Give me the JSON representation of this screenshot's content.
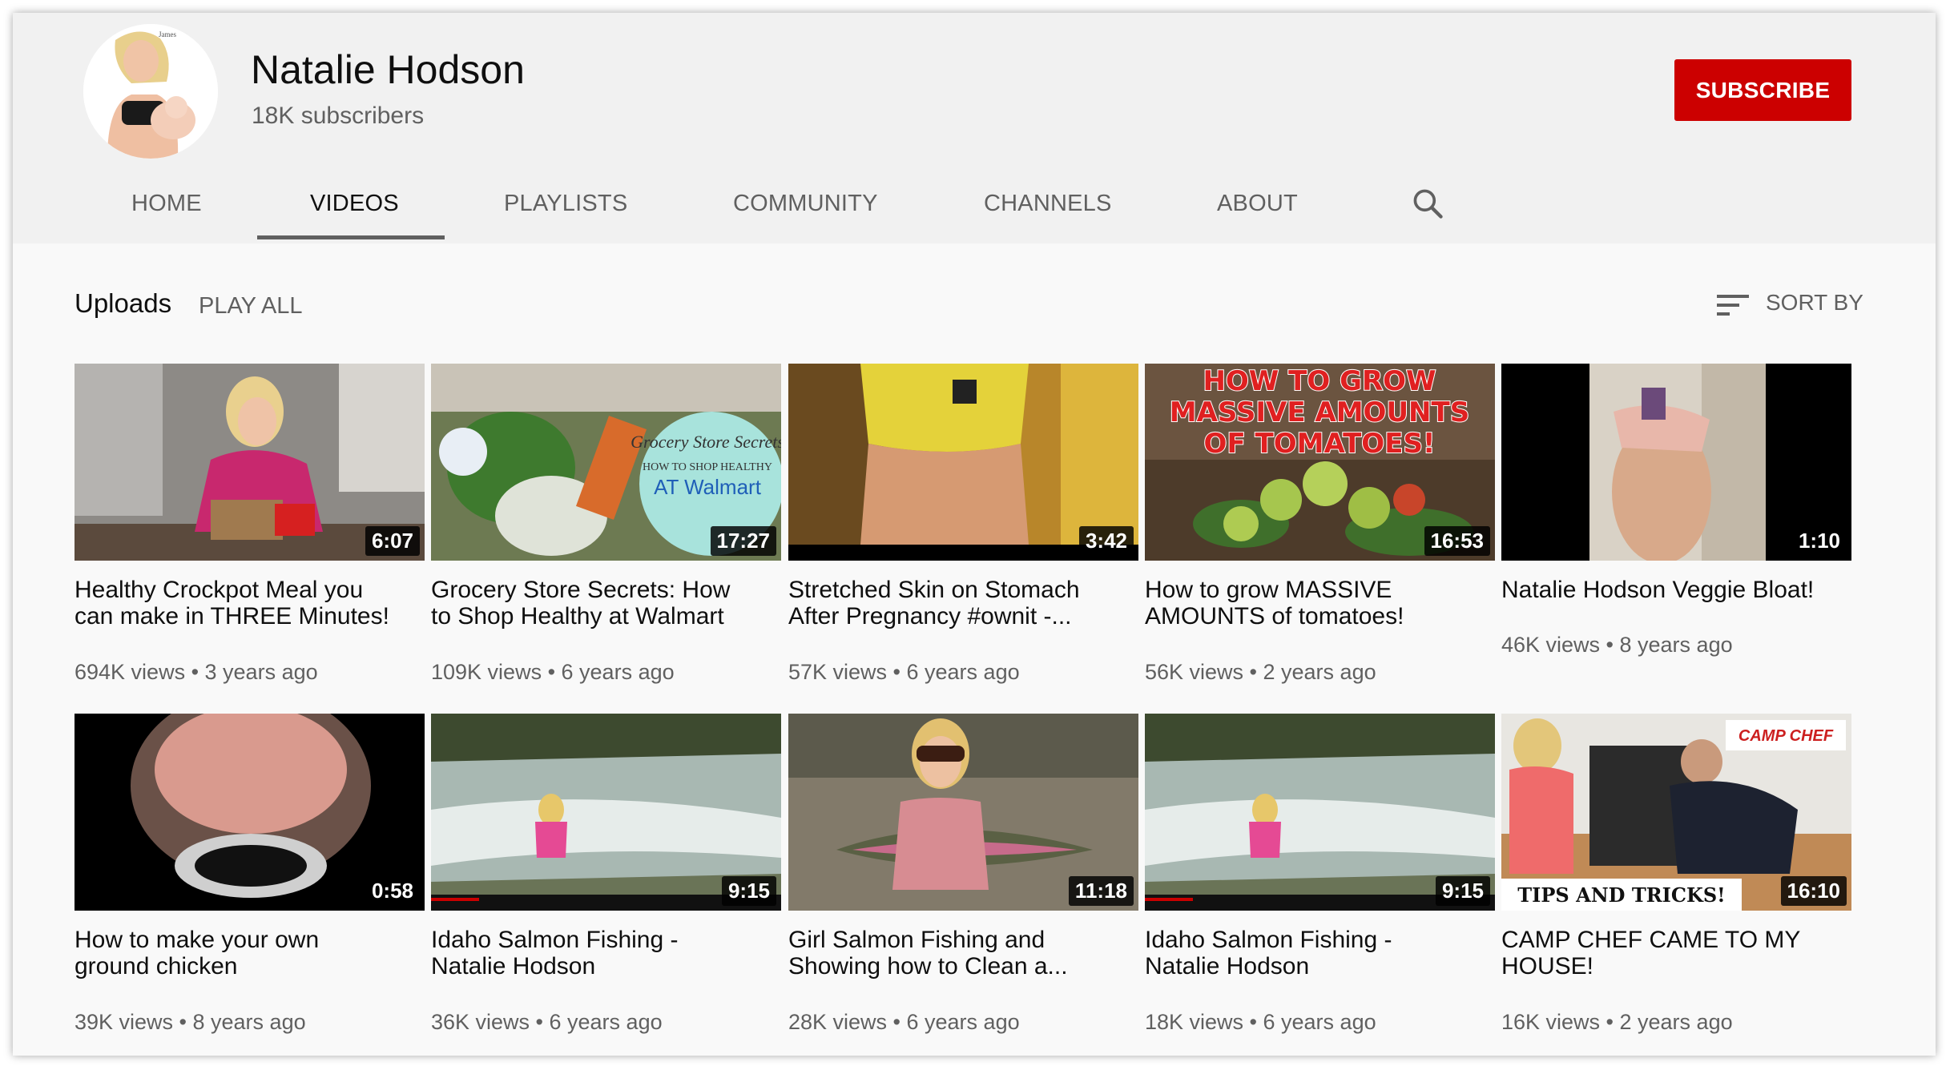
{
  "channel": {
    "name": "Natalie Hodson",
    "subscribers": "18K subscribers",
    "subscribe_label": "SUBSCRIBE",
    "avatar_watermark": "James"
  },
  "tabs": [
    {
      "label": "HOME",
      "active": false
    },
    {
      "label": "VIDEOS",
      "active": true
    },
    {
      "label": "PLAYLISTS",
      "active": false
    },
    {
      "label": "COMMUNITY",
      "active": false
    },
    {
      "label": "CHANNELS",
      "active": false
    },
    {
      "label": "ABOUT",
      "active": false
    }
  ],
  "icons": {
    "search": "search-icon",
    "sort": "sort-icon"
  },
  "section": {
    "title": "Uploads",
    "play_all": "PLAY ALL",
    "sort_by": "SORT BY"
  },
  "colors": {
    "subscribe": "#cc0000",
    "page_bg": "#f9f9f9",
    "header_bg": "#f1f1f1"
  },
  "videos": [
    {
      "title_line1": "Healthy Crockpot Meal you",
      "title_line2": "can make in THREE Minutes!",
      "duration": "6:07",
      "meta": "694K views • 3 years ago"
    },
    {
      "title_line1": "Grocery Store Secrets: How",
      "title_line2": "to Shop Healthy at Walmart",
      "duration": "17:27",
      "meta": "109K views • 6 years ago",
      "thumb_text": {
        "line1": "Grocery Store Secrets",
        "line2": "HOW TO SHOP HEALTHY",
        "line3": "AT Walmart"
      }
    },
    {
      "title_line1": "Stretched Skin on Stomach",
      "title_line2": "After Pregnancy #ownit -...",
      "duration": "3:42",
      "meta": "57K views • 6 years ago"
    },
    {
      "title_line1": "How to grow MASSIVE",
      "title_line2": "AMOUNTS of tomatoes!",
      "duration": "16:53",
      "meta": "56K views • 2 years ago",
      "thumb_text": {
        "line1": "HOW TO GROW",
        "line2": "MASSIVE AMOUNTS",
        "line3": "OF TOMATOES!"
      }
    },
    {
      "title_line1": "Natalie Hodson Veggie Bloat!",
      "title_line2": "",
      "duration": "1:10",
      "meta": "46K views • 8 years ago"
    },
    {
      "title_line1": "How to make your own",
      "title_line2": "ground chicken",
      "duration": "0:58",
      "meta": "39K views • 8 years ago"
    },
    {
      "title_line1": "Idaho Salmon Fishing -",
      "title_line2": "Natalie Hodson",
      "duration": "9:15",
      "meta": "36K views • 6 years ago"
    },
    {
      "title_line1": "Girl Salmon Fishing and",
      "title_line2": "Showing how to Clean a...",
      "duration": "11:18",
      "meta": "28K views • 6 years ago"
    },
    {
      "title_line1": "Idaho Salmon Fishing -",
      "title_line2": "Natalie Hodson",
      "duration": "9:15",
      "meta": "18K views • 6 years ago"
    },
    {
      "title_line1": "CAMP CHEF CAME TO MY",
      "title_line2": "HOUSE!",
      "duration": "16:10",
      "meta": "16K views • 2 years ago",
      "thumb_text": {
        "line1": "TIPS AND TRICKS!",
        "line2": "CAMP CHEF"
      }
    }
  ]
}
